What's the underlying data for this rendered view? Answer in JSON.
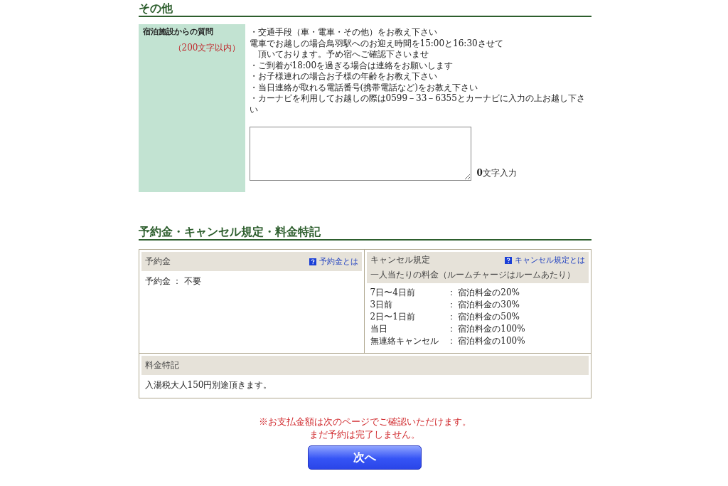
{
  "other_section": {
    "heading": "その他",
    "question": {
      "label": "宿泊施設からの質問",
      "limit": "（200文字以内）",
      "lines": [
        "・交通手段（車・電車・その他）をお教え下さい",
        "電車でお越しの場合鳥羽駅へのお迎え時間を15:00と16:30させて",
        "　頂いております。予め宿へご確認下さいませ",
        "・ご到着が18:00を過ぎる場合は連絡をお願いします",
        "・お子様連れの場合お子様の年齢をお教え下さい",
        "・当日連絡が取れる電話番号(携帯電話など)をお教え下さい",
        "・カーナビを利用してお越しの際は0599－33－6355とカーナビに入力の上お越し下さい"
      ],
      "char_count": "**0**文字入力"
    }
  },
  "policy_section": {
    "heading": "予約金・キャンセル規定・料金特記",
    "deposit": {
      "title": "予約金",
      "help_link": "予約金とは",
      "body": "予約金 ： 不要"
    },
    "cancel": {
      "title": "キャンセル規定",
      "help_link": "キャンセル規定とは",
      "subtitle": "一人当たりの料金（ルームチャージはルームあたり）",
      "rules": [
        {
          "period": "7日〜4日前",
          "fee": "： 宿泊料金の20%"
        },
        {
          "period": "3日前",
          "fee": "： 宿泊料金の30%"
        },
        {
          "period": "2日〜1日前",
          "fee": "： 宿泊料金の50%"
        },
        {
          "period": "当日",
          "fee": "： 宿泊料金の100%"
        },
        {
          "period": "無連絡キャンセル",
          "fee": "： 宿泊料金の100%"
        }
      ]
    },
    "special": {
      "title": "料金特記",
      "body": "入湯税大人150円別途頂きます。"
    }
  },
  "notice": [
    "※お支払金額は次のページでご確認いただけます。",
    "まだ予約は完了しません。"
  ],
  "next_button": "次へ"
}
